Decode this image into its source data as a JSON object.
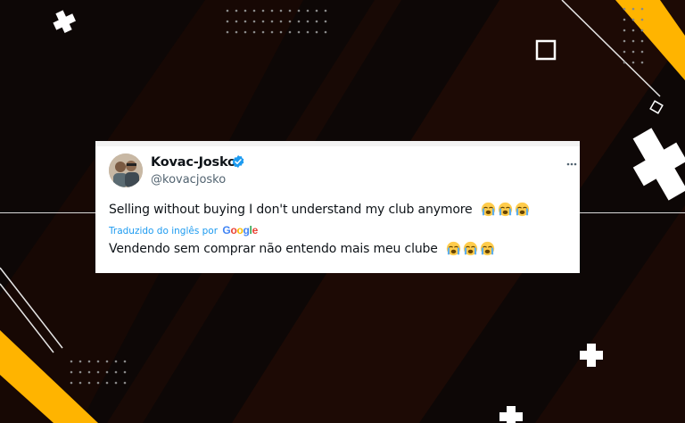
{
  "tweet": {
    "display_name": "Kovac-Josko",
    "handle": "@kovacjosko",
    "verified": true,
    "text_original": "Selling without buying I don't understand my club anymore",
    "translated_label": "Traduzido do inglês por",
    "translation_provider": "Google",
    "text_translated": "Vendendo sem comprar não entendo mais meu clube",
    "emoji": "loudly-crying-face",
    "emoji_count": 3
  },
  "colors": {
    "accent_yellow": "#ffb400",
    "link_blue": "#1d9bf0",
    "verified_blue": "#1d9bf0",
    "background_dark": "#0d0706"
  },
  "icons": [
    "plus-icon",
    "square-outline-icon",
    "verified-badge-icon",
    "more-options-icon",
    "crying-emoji-icon"
  ]
}
